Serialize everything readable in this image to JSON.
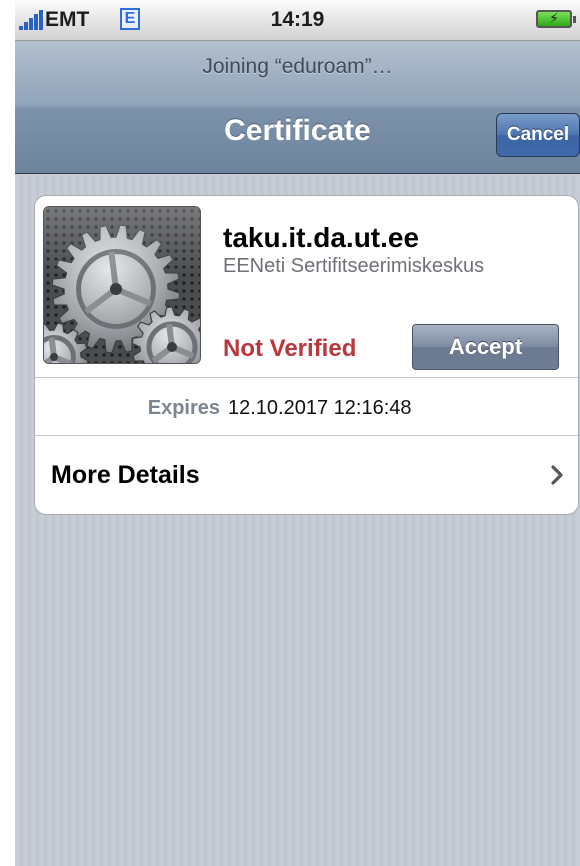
{
  "status_bar": {
    "carrier": "EMT",
    "network_type": "E",
    "time": "14:19",
    "signal_icon": "signal-bars-icon",
    "battery_icon": "battery-charging-icon",
    "battery_bolt": "⚡"
  },
  "nav_bar": {
    "prompt": "Joining “eduroam”…",
    "title": "Certificate",
    "cancel_label": "Cancel"
  },
  "certificate": {
    "icon": "gear-settings-icon",
    "host": "taku.it.da.ut.ee",
    "issuer": "EENeti Sertifitseerimiskeskus",
    "status": "Not Verified",
    "status_color": "#b8383d",
    "accept_label": "Accept",
    "expires_label": "Expires",
    "expires_value": "12.10.2017 12:16:48",
    "more_details_label": "More Details",
    "more_details_icon": "chevron-right-icon"
  },
  "colors": {
    "nav_bar": "#7c92aa",
    "background": "#c5ccd4",
    "cancel_button": "#3f6aab",
    "accept_button": "#6f7e96"
  }
}
